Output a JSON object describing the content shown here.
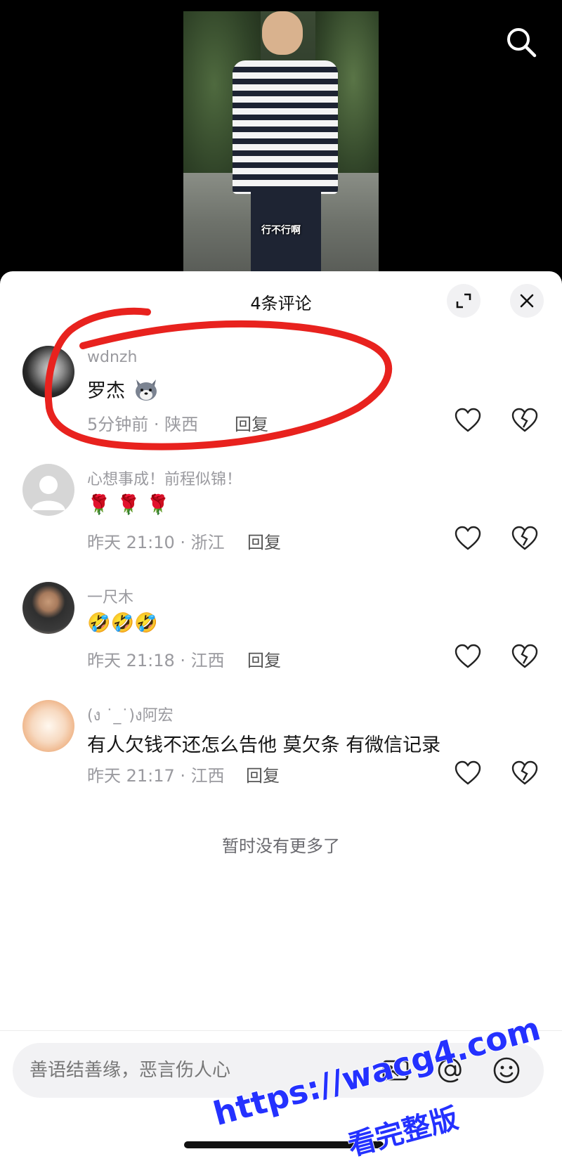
{
  "video": {
    "caption": "行不行啊",
    "search_icon": "search-icon"
  },
  "sheet": {
    "title": "4条评论",
    "expand_icon": "expand-icon",
    "close_icon": "close-icon"
  },
  "comments": [
    {
      "username": "wdnzh",
      "text": "罗杰",
      "emoji": "wolf-emoji",
      "meta": "5分钟前 · 陕西",
      "reply": "回复"
    },
    {
      "username": "心想事成！前程似锦！",
      "text": "🌹 🌹 🌹",
      "meta": "昨天 21:10 · 浙江",
      "reply": "回复"
    },
    {
      "username": "一尺木",
      "text": "🤣🤣🤣",
      "meta": "昨天 21:18 · 江西",
      "reply": "回复"
    },
    {
      "username": "(ง ˙_˙)ง阿宏",
      "text": "有人欠钱不还怎么告他 莫欠条 有微信记录",
      "meta": "昨天 21:17 · 江西",
      "reply": "回复"
    }
  ],
  "no_more": "暂时没有更多了",
  "input": {
    "placeholder": "善语结善缘，恶言伤人心"
  },
  "watermark": {
    "line1": "https://wacg4.com",
    "line2": "看完整版"
  },
  "colors": {
    "annotation_red": "#e8221e",
    "watermark_blue": "#2431ff"
  }
}
